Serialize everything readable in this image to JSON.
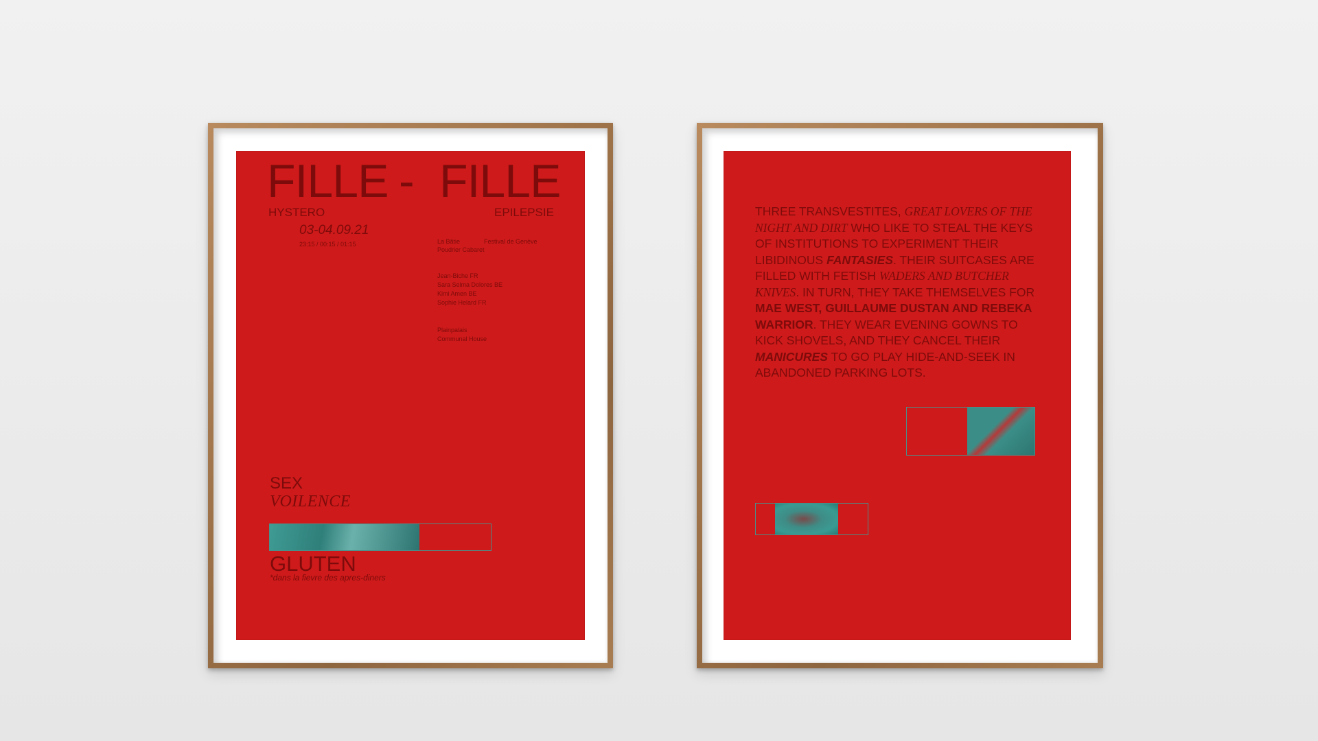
{
  "left_poster": {
    "title_left": "FILLE",
    "title_dash": "-",
    "title_right": "FILLE",
    "subtitle_left": "HYSTERO",
    "subtitle_right": "EPILEPSIE",
    "date": "03-04.09.21",
    "times": "23:15 / 00:15 / 01:15",
    "venue_line1_a": "La Bâtie",
    "venue_line1_b": "Festival de Genève",
    "venue_line2": "Poudrier Cabaret",
    "artists": [
      "Jean-Biche FR",
      "Sara Selma Dolores BE",
      "Kimi Amen BE",
      "Sophie Helard FR"
    ],
    "location_line1": "Plainpalais",
    "location_line2": "Communal House",
    "word_sex": "SEX",
    "word_violence": "VOILENCE",
    "word_gluten": "GLUTEN",
    "footnote": "*dans la fievre des apres-diners"
  },
  "right_poster": {
    "p1": "THREE TRANSVESTITES,",
    "p2": "GREAT LOVERS OF THE NIGHT AND DIRT",
    "p3": "WHO LIKE TO STEAL THE KEYS OF INSTITUTIONS TO EXPERIMENT THEIR LIBIDINOUS",
    "p4": "FANTASIES",
    "p5": ". THEIR SUITCASES ARE FILLED WITH FETISH",
    "p6": "WADERS AND BUTCHER KNIVES",
    "p7": ". IN TURN, THEY TAKE THEMSELVES FOR",
    "p8": "MAE WEST, GUILLAUME DUSTAN AND REBEKA WARRIOR",
    "p9": ". THEY WEAR EVENING GOWNS TO KICK SHOVELS, AND THEY CANCEL THEIR",
    "p10": "MANICURES",
    "p11": "TO GO PLAY HIDE-AND-SEEK IN ABANDONED PARKING LOTS."
  },
  "colors": {
    "wall": "#ececec",
    "frame_wood": "#a0744a",
    "poster_red": "#ce1a1a",
    "ink": "#7e0b0b",
    "image_teal": "#3f9b94"
  }
}
